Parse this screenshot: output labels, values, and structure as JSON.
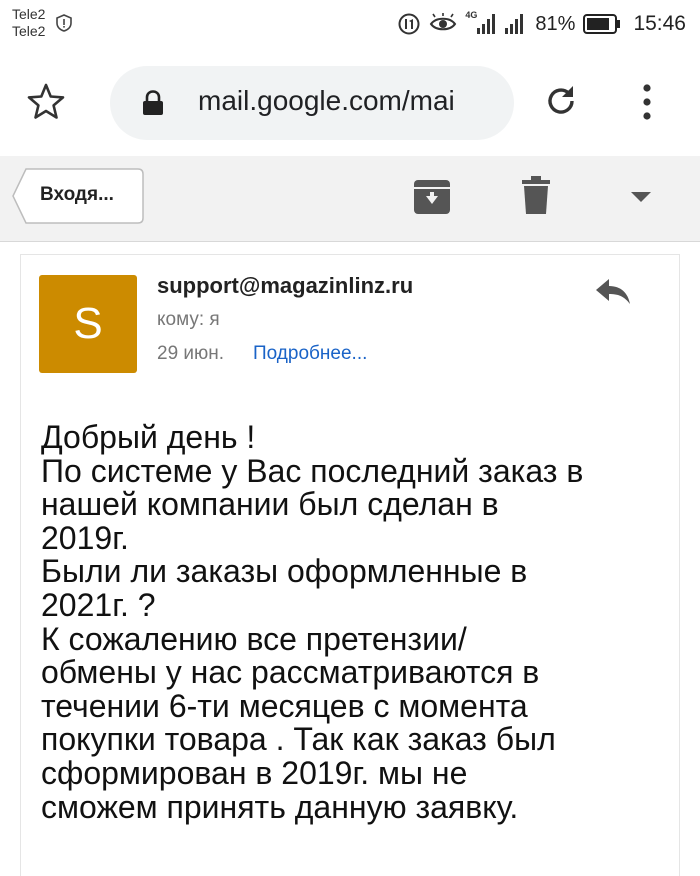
{
  "status_bar": {
    "carrier_1": "Tele2",
    "carrier_2": "Tele2",
    "network_label": "4G",
    "battery_percent": "81%",
    "time": "15:46"
  },
  "browser": {
    "url": "mail.google.com/mai"
  },
  "action_bar": {
    "back_label": "Входя..."
  },
  "email": {
    "avatar_letter": "S",
    "avatar_color": "#cc8b00",
    "sender": "support@magazinlinz.ru",
    "recipient": "кому: я",
    "date": "29 июн.",
    "details_link": "Подробнее...",
    "body_lines": [
      "Добрый день !",
      "По системе у Вас последний заказ в",
      "нашей компании был сделан в",
      "2019г.",
      "Были ли заказы оформленные в",
      "2021г. ?",
      "К сожалению все претензии/",
      "обмены у нас рассматриваются в",
      "течении 6-ти месяцев с момента",
      "покупки товара . Так как заказ был",
      "сформирован в 2019г. мы не",
      "сможем принять данную заявку."
    ]
  }
}
